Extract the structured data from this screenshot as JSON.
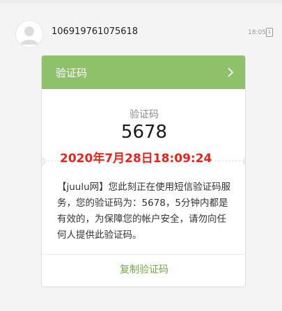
{
  "sender": {
    "number": "106919761075618",
    "time": "18:05",
    "sim_slot": "1"
  },
  "card": {
    "title": "验证码",
    "code_label": "验证码",
    "code": "5678",
    "watermark": "2020年7月28日18:09:24",
    "message": "【juulu网】您此刻正在使用短信验证码服务，您的验证码为：5678，5分钟内都是有效的，为保障您的帐户安全，请勿向任何人提供此验证码。",
    "copy_label": "复制验证码"
  },
  "colors": {
    "header_green": "#8fc06a",
    "watermark_red": "#e8231b",
    "copy_green": "#6fa943"
  },
  "icons": {
    "avatar": "person-icon",
    "header_arrow": "chevron-right-icon"
  }
}
